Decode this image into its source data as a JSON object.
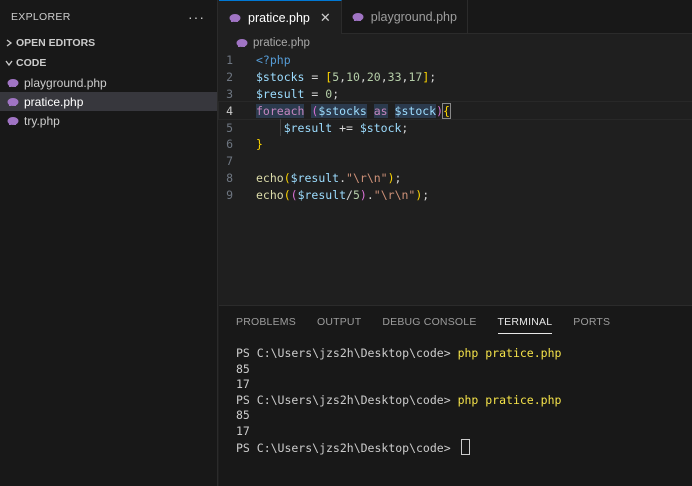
{
  "sidebar": {
    "title": "EXPLORER",
    "more": "···",
    "sections": [
      {
        "label": "OPEN EDITORS",
        "chevron": "›"
      },
      {
        "label": "CODE",
        "chevron": "⌄"
      }
    ],
    "files": [
      {
        "label": "playground.php",
        "icon": "php-icon"
      },
      {
        "label": "pratice.php",
        "icon": "php-icon",
        "active": true
      },
      {
        "label": "try.php",
        "icon": "php-icon"
      }
    ]
  },
  "tabs": [
    {
      "label": "pratice.php",
      "close": "✕",
      "active": true
    },
    {
      "label": "playground.php"
    }
  ],
  "breadcrumb": "pratice.php",
  "editor": {
    "line_numbers": [
      "1",
      "2",
      "3",
      "4",
      "5",
      "6",
      "7",
      "8",
      "9"
    ],
    "current_line": 4
  },
  "panel": {
    "tabs": [
      "PROBLEMS",
      "OUTPUT",
      "DEBUG CONSOLE",
      "TERMINAL",
      "PORTS"
    ],
    "active_tab": "TERMINAL",
    "terminal": {
      "prompt": "PS C:\\Users\\jzs2h\\Desktop\\code> ",
      "command": "php pratice.php",
      "output_1": [
        "85",
        "17"
      ],
      "output_2": [
        "85",
        "17"
      ]
    }
  },
  "colors": {
    "accent": "#0078d4",
    "php_icon": "#a074c4",
    "terminal_command": "#f5e34a"
  }
}
